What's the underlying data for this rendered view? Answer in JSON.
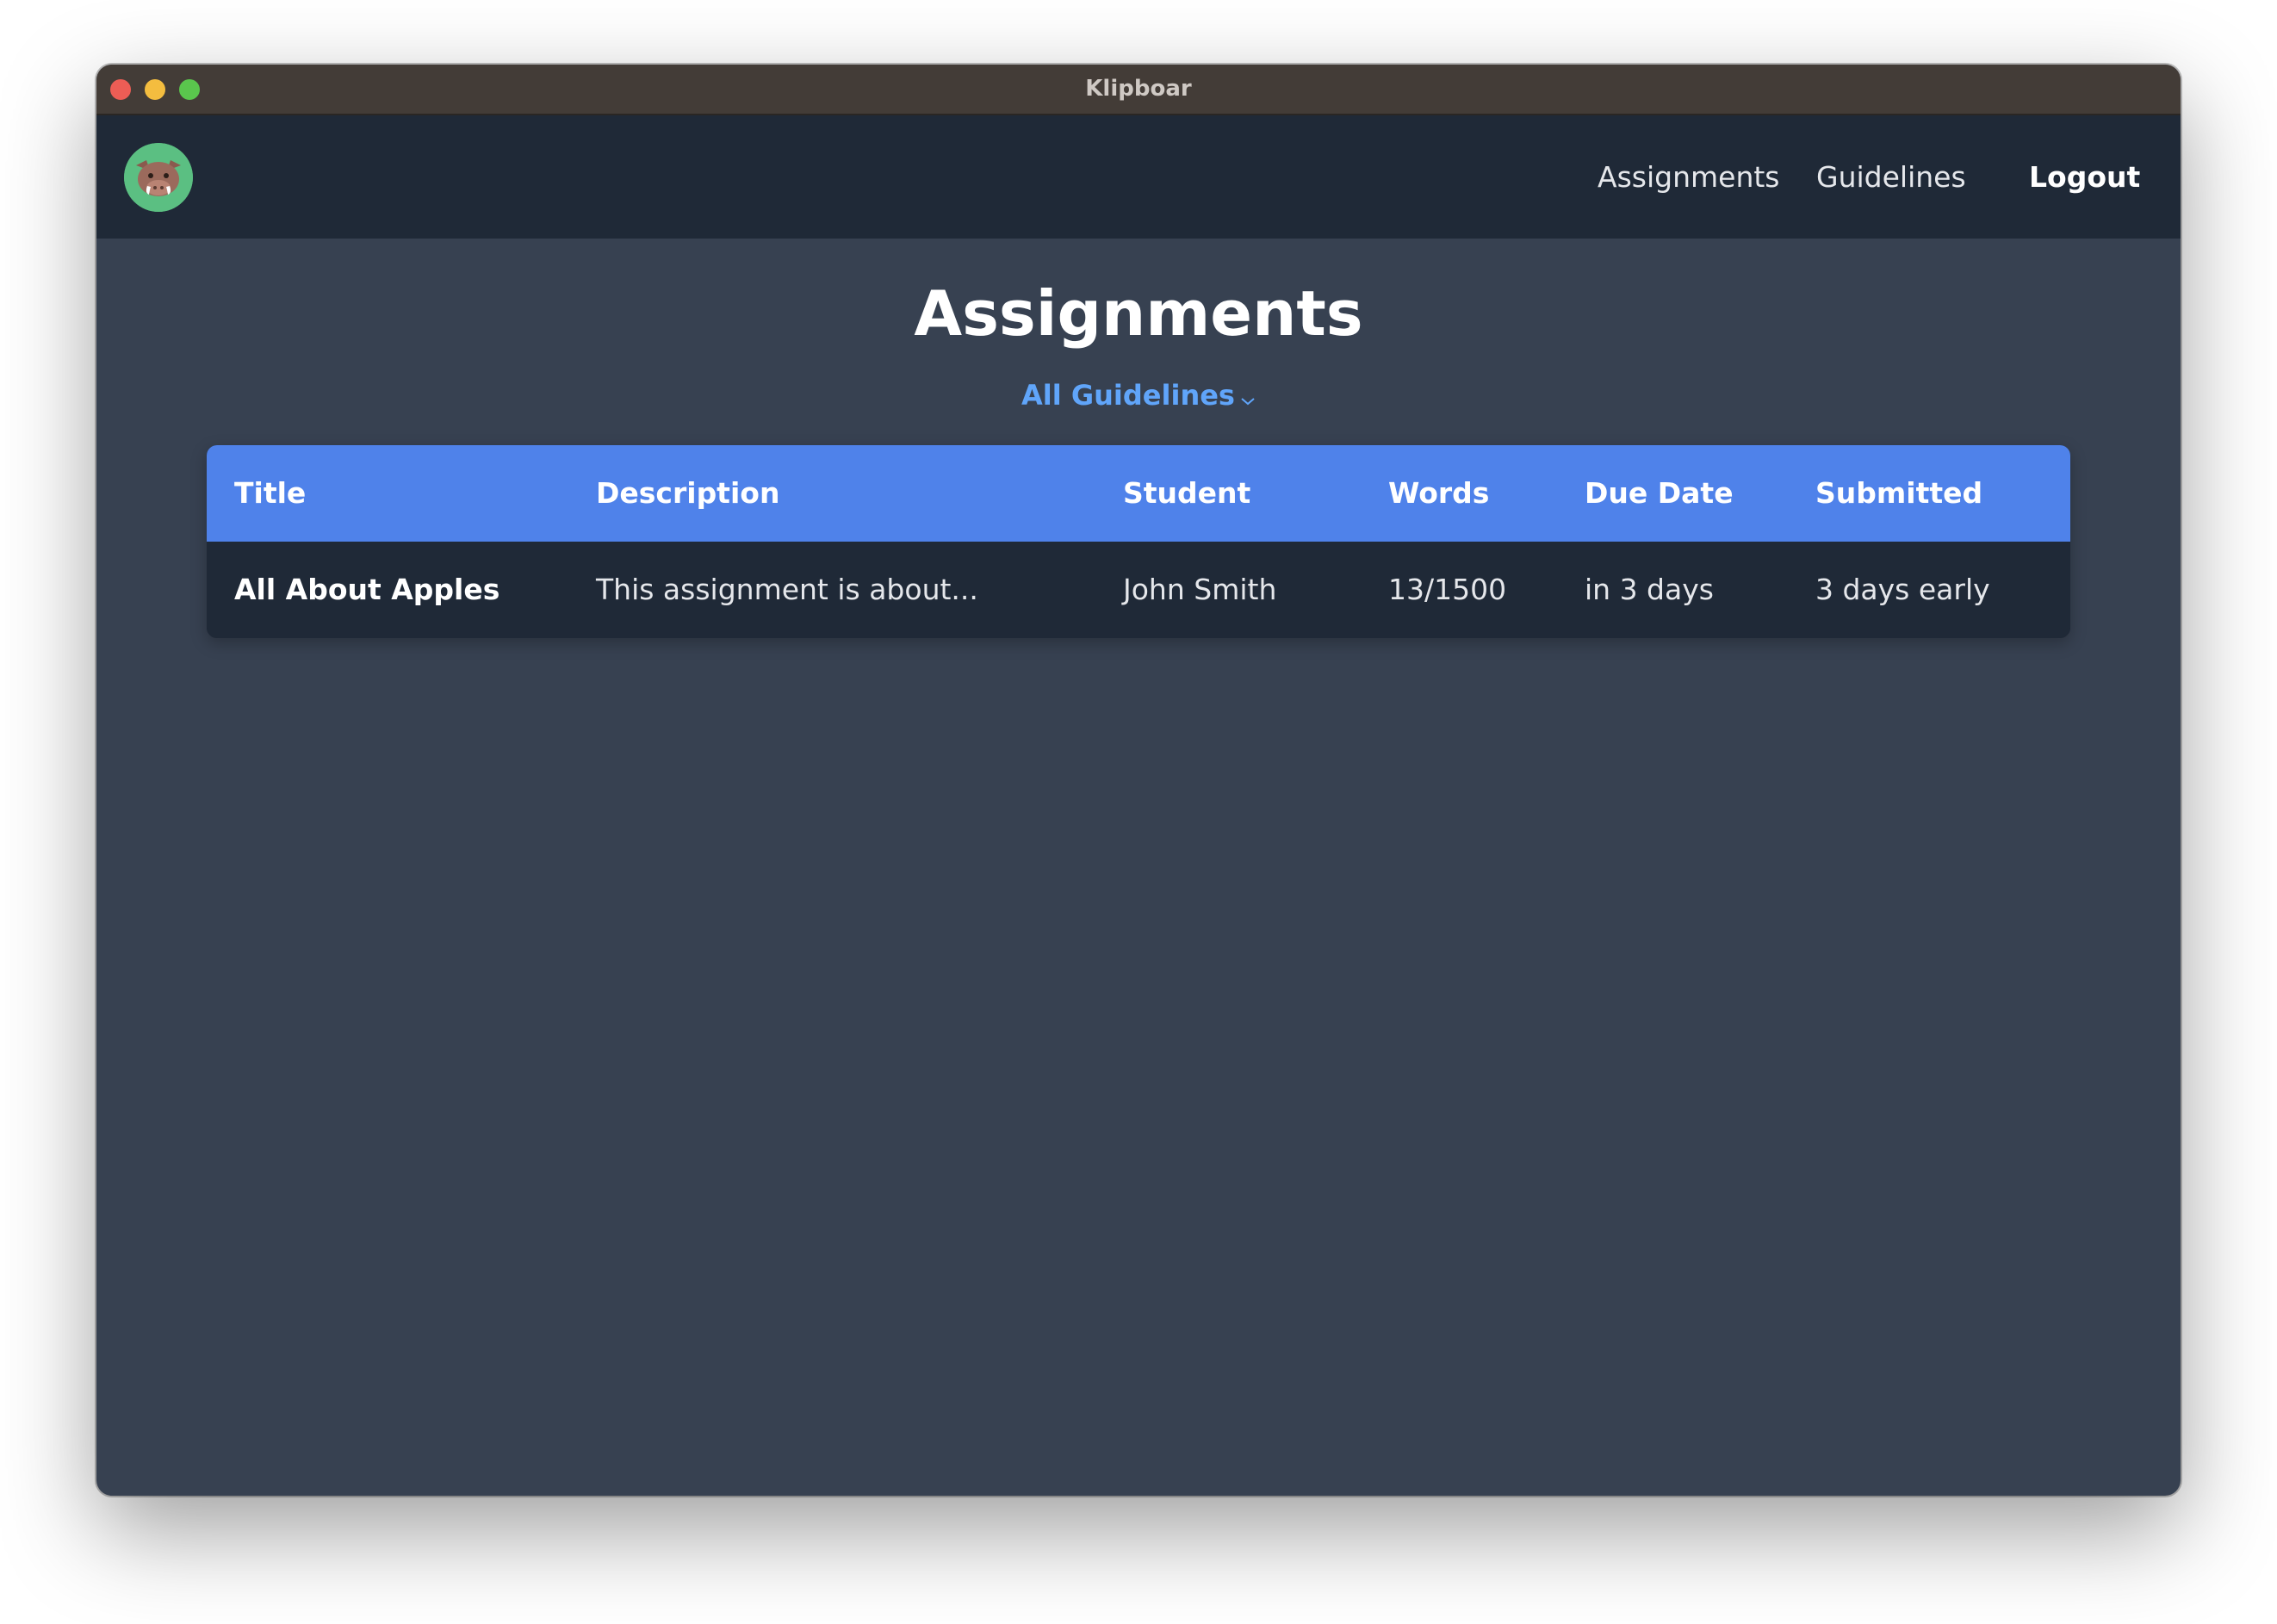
{
  "window": {
    "title": "Klipboar"
  },
  "nav": {
    "links": [
      {
        "label": "Assignments"
      },
      {
        "label": "Guidelines"
      }
    ],
    "logout_label": "Logout",
    "logo_icon": "boar-logo-icon"
  },
  "page": {
    "title": "Assignments",
    "filter_label": "All Guidelines",
    "filter_icon": "chevron-down-icon"
  },
  "table": {
    "headers": [
      "Title",
      "Description",
      "Student",
      "Words",
      "Due Date",
      "Submitted"
    ],
    "rows": [
      {
        "title": "All About Apples",
        "description": "This assignment is about...",
        "student": "John Smith",
        "words": "13/1500",
        "due": "in 3 days",
        "submitted": "3 days early"
      }
    ]
  },
  "colors": {
    "window_bg": "#374151",
    "navbar_bg": "#1f2937",
    "header_accent": "#4f82ea",
    "filter_link": "#60a5fa"
  }
}
